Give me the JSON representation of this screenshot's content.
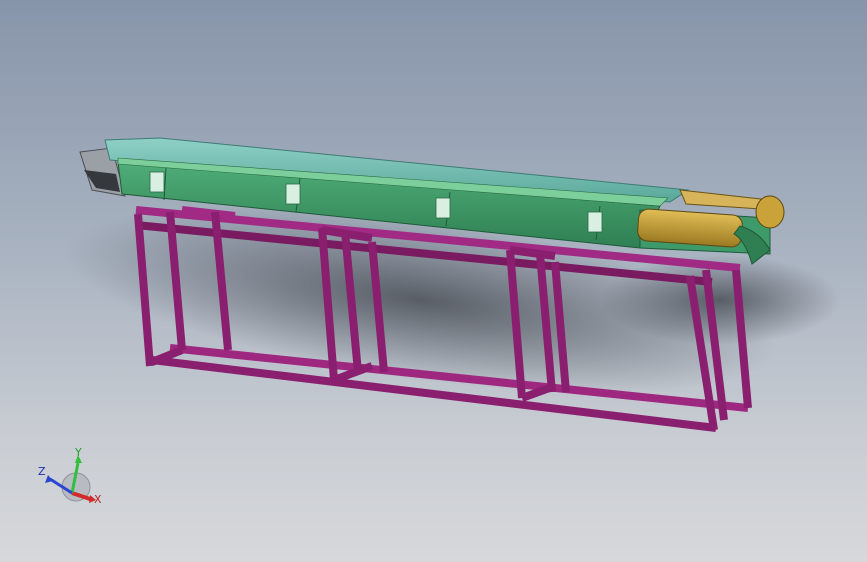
{
  "viewport": {
    "background_top": "#8795aa",
    "background_bottom": "#d6d8db"
  },
  "model": {
    "parts": [
      {
        "name": "support-frame",
        "color": "#8b1f6f"
      },
      {
        "name": "conveyor-body",
        "color": "#3f9a6a"
      },
      {
        "name": "conveyor-cover",
        "color": "#6fb7b0"
      },
      {
        "name": "drive-head",
        "color": "#c9a23a"
      },
      {
        "name": "tail-plate",
        "color": "#9aa0a6"
      }
    ]
  },
  "triad": {
    "x_label": "X",
    "y_label": "Y",
    "z_label": "Z",
    "x_color": "#d12a2a",
    "y_color": "#2fbf3a",
    "z_color": "#2a45d1"
  }
}
